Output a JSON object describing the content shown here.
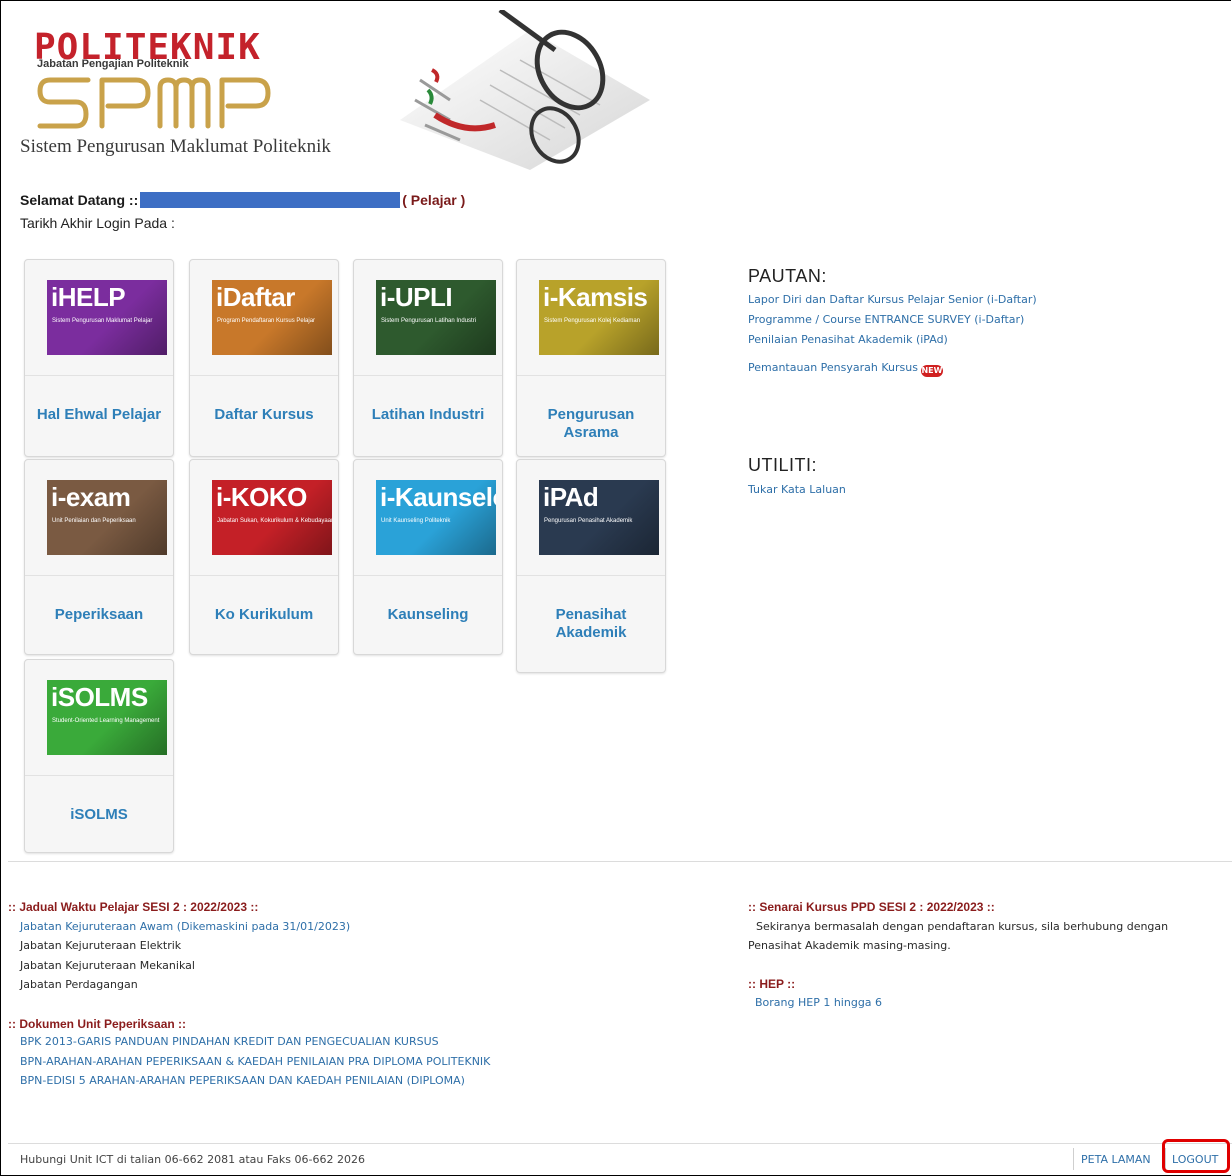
{
  "header": {
    "logo_word": "POLITEKNIK",
    "logo_sub": "Jabatan Pengajian Politeknik",
    "logo_spmp": "SPMP",
    "logo_tagline": "Sistem Pengurusan Maklumat Politeknik"
  },
  "welcome": {
    "prefix": "Selamat Datang ::",
    "role": "( Pelajar )",
    "last_login": "Tarikh Akhir Login Pada :"
  },
  "tiles": [
    {
      "label": "Hal Ehwal Pelajar",
      "thumb_title": "iHELP",
      "thumb_sub": "Sistem Pengurusan Maklumat Pelajar",
      "color": "#7b2d9e"
    },
    {
      "label": "Daftar Kursus",
      "thumb_title": "iDaftar",
      "thumb_sub": "Program Pendaftaran Kursus Pelajar",
      "color": "#c8782a"
    },
    {
      "label": "Latihan Industri",
      "thumb_title": "i-UPLI",
      "thumb_sub": "Sistem Pengurusan Latihan Industri",
      "color": "#2e5a2e"
    },
    {
      "label": "Pengurusan Asrama",
      "thumb_title": "i-Kamsis",
      "thumb_sub": "Sistem Pengurusan Kolej Kediaman",
      "color": "#b8a22a"
    },
    {
      "label": "Peperiksaan",
      "thumb_title": "i-exam",
      "thumb_sub": "Unit Penilaian dan Peperiksaan",
      "color": "#7a5a42"
    },
    {
      "label": "Ko Kurikulum",
      "thumb_title": "i-KOKO",
      "thumb_sub": "Jabatan Sukan, Kokurikulum & Kebudayaan",
      "color": "#c42027"
    },
    {
      "label": "Kaunseling",
      "thumb_title": "i-Kaunselor",
      "thumb_sub": "Unit Kaunseling Politeknik",
      "color": "#2aa2d8"
    },
    {
      "label": "Penasihat Akademik",
      "thumb_title": "iPAd",
      "thumb_sub": "Pengurusan Penasihat Akademik",
      "color": "#2a3a50"
    },
    {
      "label": "iSOLMS",
      "thumb_title": "iSOLMS",
      "thumb_sub": "Student-Oriented Learning Management",
      "color": "#3aaa3a"
    }
  ],
  "pautan": {
    "title": "PAUTAN:",
    "links": [
      "Lapor Diri dan Daftar Kursus Pelajar Senior (i-Daftar)",
      "Programme / Course ENTRANCE SURVEY (i-Daftar)",
      "Penilaian Penasihat Akademik (iPAd)",
      "Pemantauan Pensyarah Kursus"
    ],
    "new_badge": "NEW"
  },
  "utiliti": {
    "title": "UTILITI:",
    "links": [
      "Tukar Kata Laluan"
    ]
  },
  "jadual": {
    "title": ":: Jadual Waktu Pelajar SESI 2 : 2022/2023 ::",
    "items": [
      "Jabatan Kejuruteraan Awam",
      "Jabatan Kejuruteraan Elektrik",
      "Jabatan Kejuruteraan Mekanikal",
      "Jabatan Perdagangan"
    ],
    "updated_note": "(Dikemaskini pada 31/01/2023)"
  },
  "dokumen": {
    "title": ":: Dokumen Unit Peperiksaan ::",
    "items": [
      "BPK 2013-GARIS PANDUAN PINDAHAN KREDIT DAN PENGECUALIAN KURSUS",
      "BPN-ARAHAN-ARAHAN PEPERIKSAAN & KAEDAH PENILAIAN PRA DIPLOMA POLITEKNIK",
      "BPN-EDISI 5 ARAHAN-ARAHAN PEPERIKSAAN DAN KAEDAH PENILAIAN (DIPLOMA)"
    ]
  },
  "senarai": {
    "title": ":: Senarai Kursus PPD SESI 2 : 2022/2023 ::",
    "line1": "Sekiranya bermasalah dengan pendaftaran kursus, sila berhubung dengan",
    "line2": "Penasihat Akademik masing-masing."
  },
  "hep": {
    "title": ":: HEP ::",
    "link": "Borang HEP 1 hingga 6"
  },
  "footer": {
    "contact": "Hubungi Unit ICT di talian 06-662 2081 atau Faks 06-662 2026",
    "sitemap": "PETA LAMAN",
    "logout": "LOGOUT"
  },
  "colors": {
    "link": "#2e7fb8",
    "section_title": "#8a1c1c",
    "highlight": "#e00000"
  }
}
